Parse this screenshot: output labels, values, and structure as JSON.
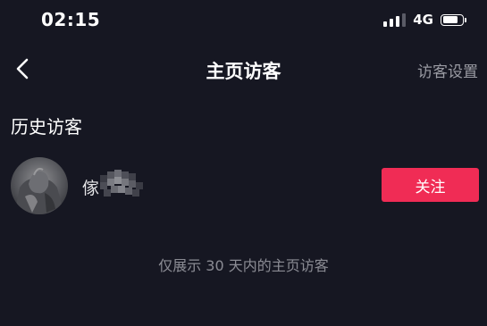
{
  "status_bar": {
    "time": "02:15",
    "network": "4G",
    "battery_level": 0.8
  },
  "nav": {
    "back_icon": "chevron-left-icon",
    "title": "主页访客",
    "action_label": "访客设置"
  },
  "section": {
    "title": "历史访客"
  },
  "visitors": [
    {
      "name": "傢",
      "follow_label": "关注"
    }
  ],
  "footer": {
    "note": "仅展示 30 天内的主页访客"
  },
  "colors": {
    "background": "#161722",
    "accent": "#f02c55",
    "secondary_text": "#9a9ba3"
  }
}
